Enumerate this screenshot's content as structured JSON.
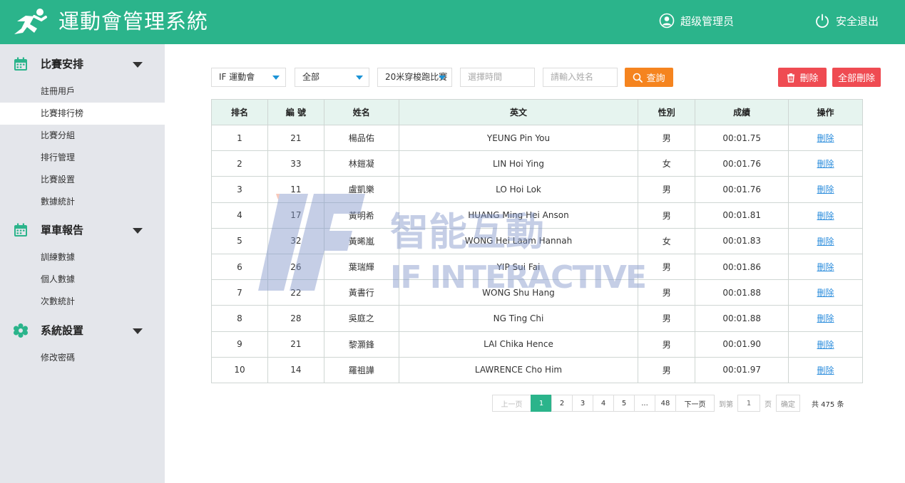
{
  "header": {
    "title": "運動會管理系統",
    "user": "超级管理员",
    "logout": "安全退出"
  },
  "sidebar": {
    "sections": [
      {
        "title": "比賽安排",
        "icon": "calendar-icon",
        "items": [
          "註冊用戶",
          "比賽排行榜",
          "比賽分組",
          "排行管理",
          "比賽設置",
          "數據統計"
        ]
      },
      {
        "title": "單車報告",
        "icon": "calendar-icon",
        "items": [
          "訓練數據",
          "個人數據",
          "次數統計"
        ]
      },
      {
        "title": "系統設置",
        "icon": "gear-icon",
        "items": [
          "修改密碼"
        ]
      }
    ],
    "active": "比賽排行榜"
  },
  "filters": {
    "event": "IF 運動會",
    "group": "全部",
    "race": "20米穿梭跑比賽",
    "time_placeholder": "選擇時間",
    "name_placeholder": "請輸入姓名",
    "query": "查詢",
    "delete": "刪除",
    "delete_all": "全部刪除"
  },
  "table": {
    "headers": [
      "排名",
      "編 號",
      "姓名",
      "英文",
      "性別",
      "成績",
      "操作"
    ],
    "rows": [
      [
        "1",
        "21",
        "楊品佑",
        "YEUNG  Pin You",
        "男",
        "00:01.75",
        "刪除"
      ],
      [
        "2",
        "33",
        "林鎧凝",
        "LIN Hoi Ying",
        "女",
        "00:01.76",
        "刪除"
      ],
      [
        "3",
        "11",
        "盧凱樂",
        "LO Hoi Lok",
        "男",
        "00:01.76",
        "刪除"
      ],
      [
        "4",
        "17",
        "黃明希",
        "HUANG Ming Hei Anson",
        "男",
        "00:01.81",
        "刪除"
      ],
      [
        "5",
        "32",
        "黃晞嵐",
        "WONG Hei Laam Hannah",
        "女",
        "00:01.83",
        "刪除"
      ],
      [
        "6",
        "26",
        "葉瑞輝",
        "YIP  Sui Fai",
        "男",
        "00:01.86",
        "刪除"
      ],
      [
        "7",
        "22",
        "黃書行",
        "WONG Shu Hang",
        "男",
        "00:01.88",
        "刪除"
      ],
      [
        "8",
        "28",
        "吳庭之",
        "NG Ting Chi",
        "男",
        "00:01.88",
        "刪除"
      ],
      [
        "9",
        "21",
        "黎灝鋒",
        "LAI Chika Hence",
        "男",
        "00:01.90",
        "刪除"
      ],
      [
        "10",
        "14",
        "羅祖譁",
        "LAWRENCE Cho Him",
        "男",
        "00:01.97",
        "刪除"
      ]
    ]
  },
  "watermark": {
    "cn": "智能互動",
    "en": "IF INTERACTIVE"
  },
  "pagination": {
    "prev": "上一页",
    "pages": [
      "1",
      "2",
      "3",
      "4",
      "5",
      "...",
      "48"
    ],
    "current": "1",
    "next": "下一页",
    "goto_label": "到第",
    "goto_value": "1",
    "page_unit": "页",
    "confirm": "确定",
    "total": "共 475 条"
  },
  "colors": {
    "primary": "#2bb48b",
    "query": "#f5841f",
    "danger": "#ef4b52",
    "link": "#2a8cdc"
  }
}
